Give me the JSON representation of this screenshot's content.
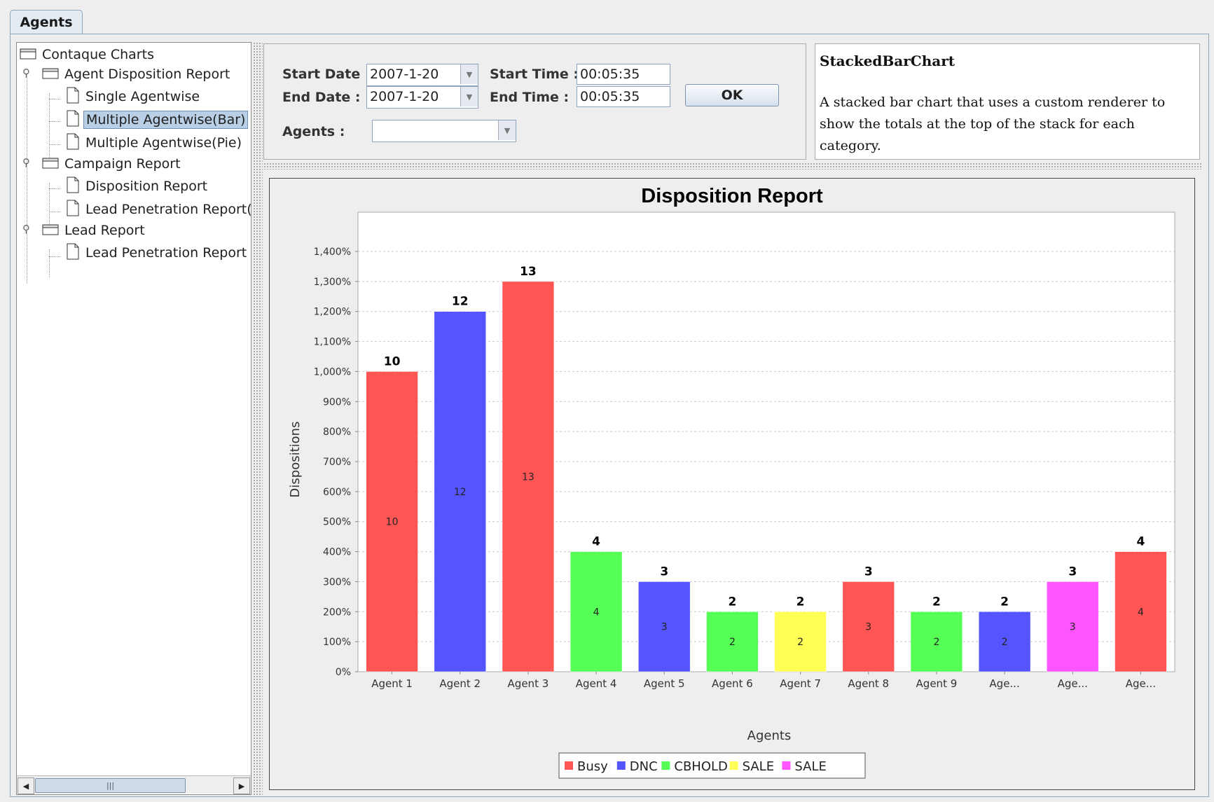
{
  "tabs": [
    {
      "label": "Agents"
    }
  ],
  "tree": {
    "root": "Contaque Charts",
    "groups": [
      {
        "label": "Agent Disposition Report",
        "items": [
          "Single Agentwise",
          "Multiple Agentwise(Bar)",
          "Multiple Agentwise(Pie)"
        ]
      },
      {
        "label": "Campaign Report",
        "items": [
          "Disposition Report",
          "Lead Penetration Report("
        ]
      },
      {
        "label": "Lead Report",
        "items": [
          "Lead Penetration Report"
        ]
      }
    ],
    "selected": "Multiple Agentwise(Bar)"
  },
  "form": {
    "start_date_label": "Start Date :",
    "start_date_value": "2007-1-20",
    "end_date_label": "End Date :",
    "end_date_value": "2007-1-20",
    "start_time_label": "Start Time :",
    "start_time_value": "00:05:35",
    "end_time_label": "End Time :",
    "end_time_value": "00:05:35",
    "ok_label": "OK",
    "agents_label": "Agents :",
    "agents_value": ""
  },
  "description": {
    "title": "StackedBarChart",
    "text": "A stacked bar chart that uses a custom renderer to show the totals at the top of the stack for each category."
  },
  "colors": {
    "Busy": "#ff5555",
    "DNC": "#5555ff",
    "CBHOLD": "#55ff55",
    "SALE_yellow": "#ffff55",
    "SALE_magenta": "#ff55ff"
  },
  "chart_data": {
    "type": "bar",
    "stacked": true,
    "title": "Disposition Report",
    "xlabel": "Agents",
    "ylabel": "Dispositions",
    "ylim": [
      0,
      1400
    ],
    "yticks": [
      "0%",
      "100%",
      "200%",
      "300%",
      "400%",
      "500%",
      "600%",
      "700%",
      "800%",
      "900%",
      "1,000%",
      "1,100%",
      "1,200%",
      "1,300%",
      "1,400%"
    ],
    "grid": true,
    "legend_position": "bottom",
    "categories": [
      "Agent 1",
      "Agent 2",
      "Agent 3",
      "Agent 4",
      "Agent 5",
      "Agent 6",
      "Agent 7",
      "Agent 8",
      "Agent 9",
      "Age...",
      "Age...",
      "Age..."
    ],
    "bars": [
      {
        "series": "Busy",
        "color": "#ff5555",
        "value": 10,
        "label": "10",
        "total_label": "10"
      },
      {
        "series": "DNC",
        "color": "#5555ff",
        "value": 12,
        "label": "12",
        "total_label": "12"
      },
      {
        "series": "Busy",
        "color": "#ff5555",
        "value": 13,
        "label": "13",
        "total_label": "13"
      },
      {
        "series": "CBHOLD",
        "color": "#55ff55",
        "value": 4,
        "label": "4",
        "total_label": "4"
      },
      {
        "series": "DNC",
        "color": "#5555ff",
        "value": 3,
        "label": "3",
        "total_label": "3"
      },
      {
        "series": "CBHOLD",
        "color": "#55ff55",
        "value": 2,
        "label": "2",
        "total_label": "2"
      },
      {
        "series": "SALE",
        "color": "#ffff55",
        "value": 2,
        "label": "2",
        "total_label": "2"
      },
      {
        "series": "Busy",
        "color": "#ff5555",
        "value": 3,
        "label": "3",
        "total_label": "3"
      },
      {
        "series": "CBHOLD",
        "color": "#55ff55",
        "value": 2,
        "label": "2",
        "total_label": "2"
      },
      {
        "series": "DNC",
        "color": "#5555ff",
        "value": 2,
        "label": "2",
        "total_label": "2"
      },
      {
        "series": "SALE",
        "color": "#ff55ff",
        "value": 3,
        "label": "3",
        "total_label": "3"
      },
      {
        "series": "Busy",
        "color": "#ff5555",
        "value": 4,
        "label": "4",
        "total_label": "4"
      }
    ],
    "legend": [
      {
        "name": "Busy",
        "color": "#ff5555"
      },
      {
        "name": "DNC",
        "color": "#5555ff"
      },
      {
        "name": "CBHOLD",
        "color": "#55ff55"
      },
      {
        "name": "SALE",
        "color": "#ffff55"
      },
      {
        "name": "SALE",
        "color": "#ff55ff"
      }
    ]
  }
}
